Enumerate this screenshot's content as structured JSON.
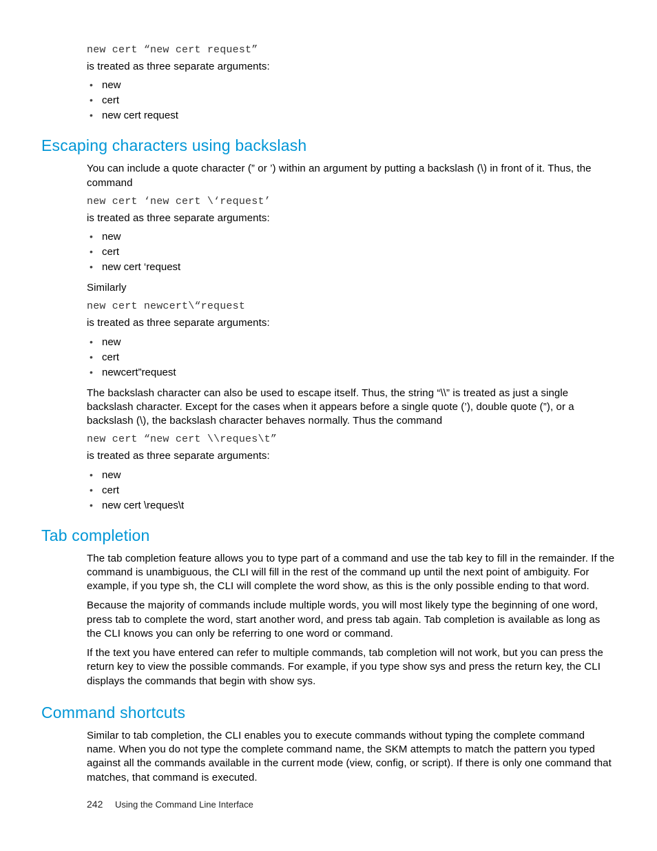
{
  "intro": {
    "code": "new cert “new cert request”",
    "desc": "is treated as three separate arguments:",
    "bullets": [
      "new",
      "cert",
      "new cert request"
    ]
  },
  "sec1": {
    "title": "Escaping characters using backslash",
    "p1": "You can include a quote character (” or ’) within an argument by putting a backslash (\\) in front of it.  Thus, the command",
    "code1": "new cert ‘new cert \\‘request’",
    "desc1": "is treated as three separate arguments:",
    "bullets1": [
      "new",
      "cert",
      "new cert ‘request"
    ],
    "similarly": "Similarly",
    "code2": "new cert newcert\\“request",
    "desc2": "is treated as three separate arguments:",
    "bullets2": [
      "new",
      "cert",
      "newcert”request"
    ],
    "p2": "The backslash character can also be used to escape itself.  Thus, the string “\\\\” is treated as just a single backslash character.  Except for the cases when it appears before a single quote (’), double quote (”), or a backslash (\\), the backslash character behaves normally.  Thus the command",
    "code3": "new cert “new cert \\\\reques\\t”",
    "desc3": "is treated as three separate arguments:",
    "bullets3": [
      "new",
      "cert",
      "new cert \\reques\\t"
    ]
  },
  "sec2": {
    "title": "Tab completion",
    "p1": "The tab completion feature allows you to type part of a command and use the tab key to fill in the remainder.  If the command is unambiguous, the CLI will fill in the rest of the command up until the next point of ambiguity.  For example, if you type sh, the CLI will complete the word show, as this is the only possible ending to that word.",
    "p2": "Because the majority of commands include multiple words, you will most likely type the beginning of one word, press tab to complete the word, start another word, and press tab again.  Tab completion is available as long as the CLI knows you can only be referring to one word or command.",
    "p3": "If the text you have entered can refer to multiple commands, tab completion will not work, but you can press the return key to view the possible commands.  For example, if you type show sys and press the return key, the CLI displays the commands that begin with show sys."
  },
  "sec3": {
    "title": "Command shortcuts",
    "p1": "Similar to tab completion, the CLI enables you to execute commands without typing the complete command name.  When you do not type the complete command name, the SKM attempts to match the pattern you typed against all the commands available in the current mode (view, config, or script).  If there is only one command that matches, that command is executed."
  },
  "footer": {
    "page": "242",
    "title": "Using the Command Line Interface"
  }
}
